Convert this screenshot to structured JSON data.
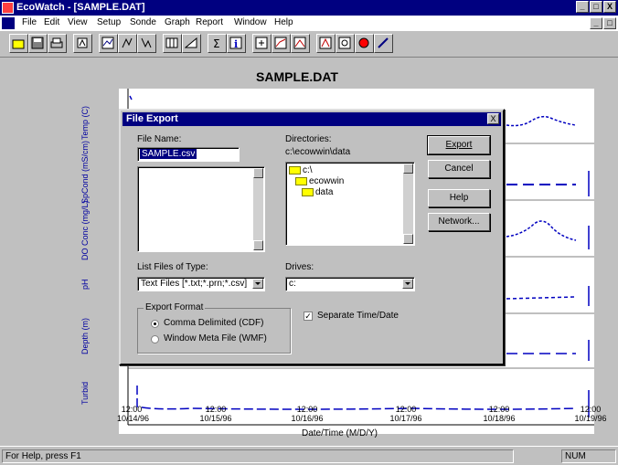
{
  "window": {
    "title": "EcoWatch - [SAMPLE.DAT]",
    "controls": [
      "_",
      "□",
      "X"
    ]
  },
  "menu": {
    "items": [
      "File",
      "Edit",
      "View",
      "Setup",
      "Sonde",
      "Graph",
      "Report",
      "Window",
      "Help"
    ]
  },
  "toolbar": {
    "buttons": [
      "open-icon",
      "save-icon",
      "print-icon",
      "sonde-icon",
      "graph-icon",
      "report-icon",
      "table-icon",
      "trend-icon",
      "statistics-icon",
      "info-icon",
      "zoom-icon",
      "plot-icon",
      "scatter-icon",
      "palette-icon",
      "help-icon",
      "whats-this-icon"
    ]
  },
  "chart": {
    "title": "SAMPLE.DAT",
    "xlabel": "Date/Time (M/D/Y)",
    "x_ticks": [
      "12:00",
      "12:00",
      "12:00",
      "12:00",
      "12:00",
      "12:00"
    ],
    "x_dates": [
      "10/14/96",
      "10/15/96",
      "10/16/96",
      "10/17/96",
      "10/18/96",
      "10/19/96"
    ],
    "panels": [
      {
        "ylabel": "Temp (C)"
      },
      {
        "ylabel": "SpCond (mS/cm)"
      },
      {
        "ylabel": "DO Conc (mg/L)"
      },
      {
        "ylabel": "pH"
      },
      {
        "ylabel": "Depth (m)"
      },
      {
        "ylabel": "Turbid"
      }
    ]
  },
  "dialog": {
    "title": "File Export",
    "file_name_label": "File Name:",
    "file_name_value": "SAMPLE.csv",
    "directories_label": "Directories:",
    "directory_path": "c:\\ecowwin\\data",
    "tree": [
      "c:\\",
      "ecowwin",
      "data"
    ],
    "list_files_label": "List Files of Type:",
    "list_files_value": "Text Files [*.txt;*.prn;*.csv]",
    "drives_label": "Drives:",
    "drives_value": "c:",
    "export_format_label": "Export Format",
    "format_options": [
      "Comma Delimited (CDF)",
      "Window Meta File (WMF)"
    ],
    "separate_label": "Separate Time/Date",
    "buttons": {
      "export": "Export",
      "cancel": "Cancel",
      "help": "Help",
      "network": "Network..."
    }
  },
  "status": {
    "left": "For Help, press F1",
    "right": "NUM"
  }
}
